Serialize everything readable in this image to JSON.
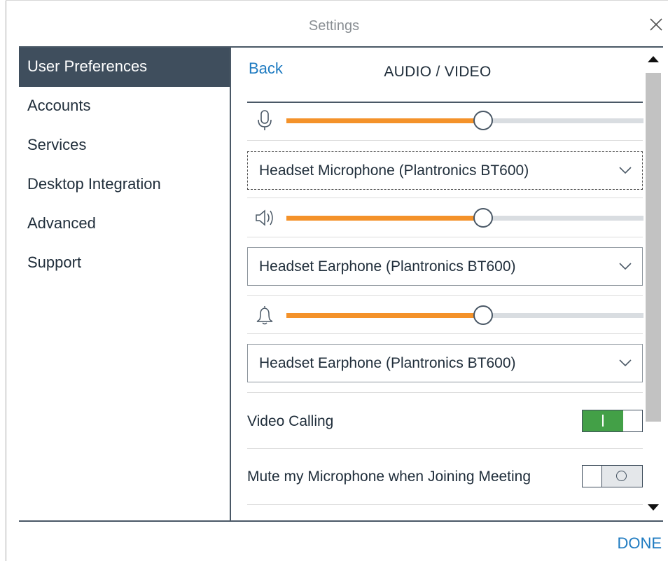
{
  "window": {
    "title": "Settings"
  },
  "sidebar": {
    "items": [
      {
        "label": "User Preferences",
        "active": true
      },
      {
        "label": "Accounts"
      },
      {
        "label": "Services"
      },
      {
        "label": "Desktop Integration"
      },
      {
        "label": "Advanced"
      },
      {
        "label": "Support"
      }
    ]
  },
  "content": {
    "back_label": "Back",
    "section_title": "AUDIO / VIDEO",
    "microphone": {
      "icon": "microphone-icon",
      "volume_percent": 55,
      "device": "Headset Microphone (Plantronics BT600)"
    },
    "speaker": {
      "icon": "speaker-icon",
      "volume_percent": 55,
      "device": "Headset Earphone (Plantronics BT600)"
    },
    "ringer": {
      "icon": "bell-icon",
      "volume_percent": 55,
      "device": "Headset Earphone (Plantronics BT600)"
    },
    "video_calling": {
      "label": "Video Calling",
      "on": true
    },
    "mute_on_join": {
      "label": "Mute my Microphone when Joining Meeting",
      "on": false
    }
  },
  "footer": {
    "done_label": "DONE"
  },
  "colors": {
    "accent": "#f4922a",
    "link": "#1f7bc1",
    "sidebar_active": "#3f4e5d",
    "toggle_on": "#43a047"
  }
}
